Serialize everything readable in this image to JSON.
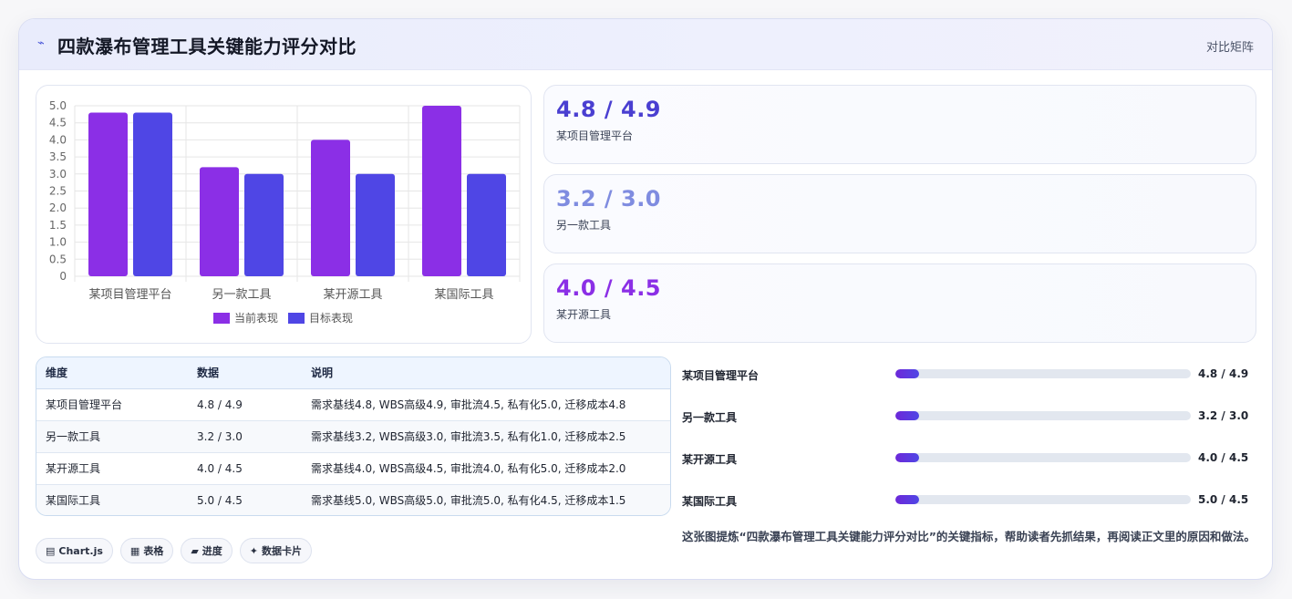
{
  "header": {
    "icon": "trend-icon",
    "title": "四款瀑布管理工具关键能力评分对比",
    "right_label": "对比矩阵"
  },
  "colors": {
    "current": "#8b2fe6",
    "target": "#4f46e5",
    "kpi_1": "#4a3fd1",
    "kpi_2": "#7f8ce0",
    "kpi_3": "#8b2fe6"
  },
  "chart_data": {
    "type": "bar",
    "categories": [
      "某项目管理平台",
      "另一款工具",
      "某开源工具",
      "某国际工具"
    ],
    "series": [
      {
        "name": "当前表现",
        "values": [
          4.8,
          3.2,
          4.0,
          5.0
        ]
      },
      {
        "name": "目标表现",
        "values": [
          4.8,
          3.0,
          3.0,
          3.0
        ]
      }
    ],
    "ylim": [
      0,
      5
    ],
    "yticks": [
      "5.0",
      "4.5",
      "4.0",
      "3.5",
      "3.0",
      "2.5",
      "2.0",
      "1.5",
      "1.0",
      "0.5",
      "0"
    ],
    "grid": true,
    "legend_position": "bottom"
  },
  "kpis": [
    {
      "value": "4.8 / 4.9",
      "label": "某项目管理平台"
    },
    {
      "value": "3.2 / 3.0",
      "label": "另一款工具"
    },
    {
      "value": "4.0 / 4.5",
      "label": "某开源工具"
    }
  ],
  "table": {
    "headers": [
      "维度",
      "数据",
      "说明"
    ],
    "rows": [
      [
        "某项目管理平台",
        "4.8 / 4.9",
        "需求基线4.8, WBS高级4.9, 审批流4.5, 私有化5.0, 迁移成本4.8"
      ],
      [
        "另一款工具",
        "3.2 / 3.0",
        "需求基线3.2, WBS高级3.0, 审批流3.5, 私有化1.0, 迁移成本2.5"
      ],
      [
        "某开源工具",
        "4.0 / 4.5",
        "需求基线4.0, WBS高级4.5, 审批流4.0, 私有化5.0, 迁移成本2.0"
      ],
      [
        "某国际工具",
        "5.0 / 4.5",
        "需求基线5.0, WBS高级5.0, 审批流5.0, 私有化4.5, 迁移成本1.5"
      ]
    ]
  },
  "progress": [
    {
      "label": "某项目管理平台",
      "value": "4.8 / 4.9",
      "fill_fraction": 0.08
    },
    {
      "label": "另一款工具",
      "value": "3.2 / 3.0",
      "fill_fraction": 0.08
    },
    {
      "label": "某开源工具",
      "value": "4.0 / 4.5",
      "fill_fraction": 0.08
    },
    {
      "label": "某国际工具",
      "value": "5.0 / 4.5",
      "fill_fraction": 0.08
    }
  ],
  "tags": [
    {
      "icon": "chart-icon",
      "glyph": "▤",
      "label": "Chart.js"
    },
    {
      "icon": "table-icon",
      "glyph": "▦",
      "label": "表格"
    },
    {
      "icon": "progress-icon",
      "glyph": "▰",
      "label": "进度"
    },
    {
      "icon": "sparkle-icon",
      "glyph": "✦",
      "label": "数据卡片"
    }
  ],
  "note": "这张图提炼“四款瀑布管理工具关键能力评分对比”的关键指标，帮助读者先抓结果，再阅读正文里的原因和做法。"
}
